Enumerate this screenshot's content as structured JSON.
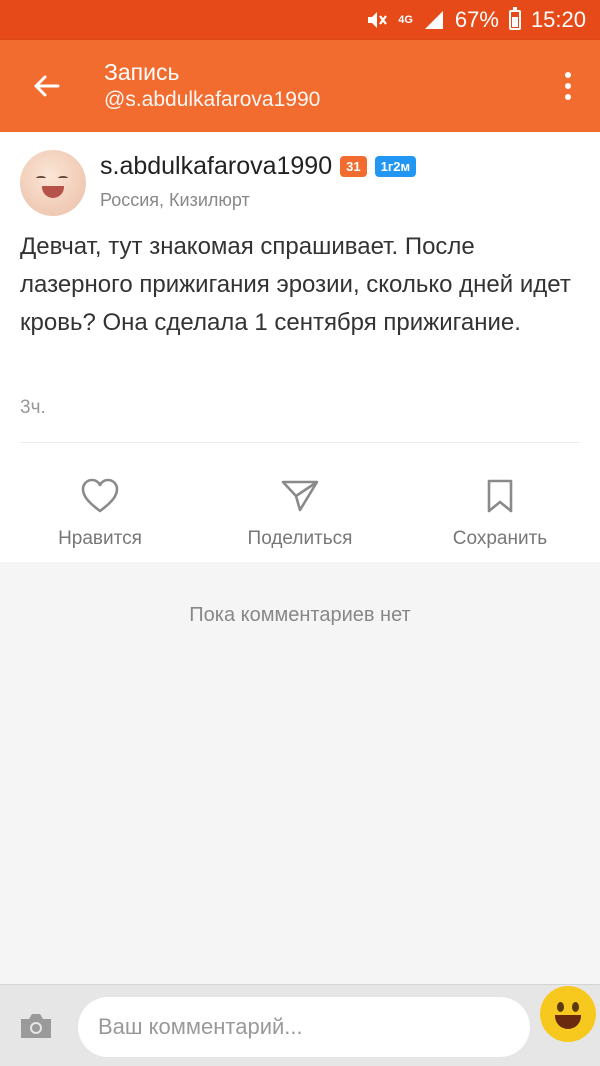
{
  "status_bar": {
    "network": "4G",
    "battery": "67%",
    "time": "15:20"
  },
  "app_bar": {
    "title": "Запись",
    "subtitle": "@s.abdulkafarova1990"
  },
  "post": {
    "username": "s.abdulkafarova1990",
    "badge_age": "31",
    "badge_tenure": "1г2м",
    "location": "Россия, Кизилюрт",
    "text": "Девчат, тут знакомая спрашивает. После лазерного прижигания эрозии, сколько дней идет кровь? Она сделала 1 сентября прижигание.",
    "time": "3ч."
  },
  "actions": {
    "like": "Нравится",
    "share": "Поделиться",
    "save": "Сохранить"
  },
  "comments": {
    "empty_text": "Пока комментариев нет"
  },
  "composer": {
    "placeholder": "Ваш комментарий..."
  },
  "colors": {
    "status_bar": "#e64a19",
    "app_bar": "#f26b2f",
    "badge_blue": "#2196f3",
    "emoji": "#f7c81e"
  },
  "icons": [
    "mute-icon",
    "signal-icon",
    "battery-icon",
    "back-arrow-icon",
    "more-vert-icon",
    "heart-icon",
    "send-icon",
    "bookmark-icon",
    "camera-icon",
    "smiley-icon"
  ]
}
